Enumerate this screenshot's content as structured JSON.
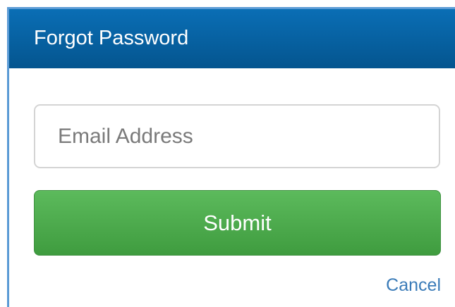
{
  "modal": {
    "title": "Forgot Password"
  },
  "form": {
    "email_placeholder": "Email Address",
    "email_value": "",
    "submit_label": "Submit",
    "cancel_label": "Cancel"
  },
  "colors": {
    "header_bg": "#0a6eb5",
    "submit_bg": "#4cae4c",
    "link": "#3a7bb8",
    "frame_border": "#5b9bd5"
  }
}
